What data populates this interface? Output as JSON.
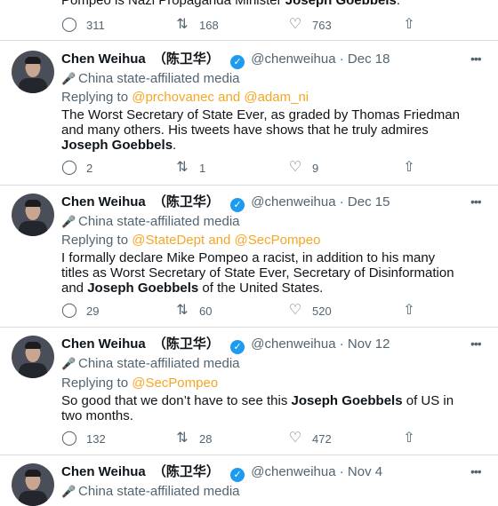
{
  "top_partial": {
    "text_prefix": "Pompeo is Nazi Propaganda Minister ",
    "text_bold": "Joseph Goebbels",
    "text_suffix": ".",
    "replies": "311",
    "retweets": "168",
    "likes": "763"
  },
  "tweets": [
    {
      "name": "Chen Weihua",
      "name_cn": "（陈卫华）",
      "handle": "@chenweihua",
      "date": "· Dec 18",
      "label": "China state-affiliated media",
      "replying_prefix": "Replying to ",
      "replying_to": "@prchovanec and @adam_ni",
      "text_lines": [
        "The Worst Secretary of State Ever, as graded by Thomas Friedman",
        "and many others.  His tweets have shows that he truly admires"
      ],
      "text_bold": "Joseph Goebbels",
      "text_suffix": ".",
      "replies": "2",
      "retweets": "1",
      "likes": "9"
    },
    {
      "name": "Chen Weihua",
      "name_cn": "（陈卫华）",
      "handle": "@chenweihua",
      "date": "· Dec 15",
      "label": "China state-affiliated media",
      "replying_prefix": "Replying to ",
      "replying_to": "@StateDept and @SecPompeo",
      "text_lines": [
        "I formally declare Mike Pompeo a racist, in addition to his many",
        "titles as Worst Secretary of State Ever, Secretary of Disinformation"
      ],
      "text_prefix3": "and ",
      "text_bold": "Joseph Goebbels",
      "text_suffix": " of the United States.",
      "replies": "29",
      "retweets": "60",
      "likes": "520"
    },
    {
      "name": "Chen Weihua",
      "name_cn": "（陈卫华）",
      "handle": "@chenweihua",
      "date": "· Nov 12",
      "label": "China state-affiliated media",
      "replying_prefix": "Replying to ",
      "replying_to": "@SecPompeo",
      "text_prefix": "So good that we don’t have to see this ",
      "text_bold": "Joseph Goebbels",
      "text_suffix": " of US in",
      "text_line2": "two months.",
      "replies": "132",
      "retweets": "28",
      "likes": "472"
    },
    {
      "name": "Chen Weihua",
      "name_cn": "（陈卫华）",
      "handle": "@chenweihua",
      "date": "· Nov 4",
      "label": "China state-affiliated media"
    }
  ],
  "icons": {
    "reply": "reply-icon",
    "retweet": "retweet-icon",
    "like": "heart-icon",
    "share": "share-icon",
    "more": "more-icon",
    "verified": "verified-badge-icon",
    "state_media": "microphone-icon"
  },
  "colors": {
    "mention": "#f5a623",
    "verified": "#1d9bf0",
    "muted": "#536471",
    "separator": "#d7dde1"
  }
}
